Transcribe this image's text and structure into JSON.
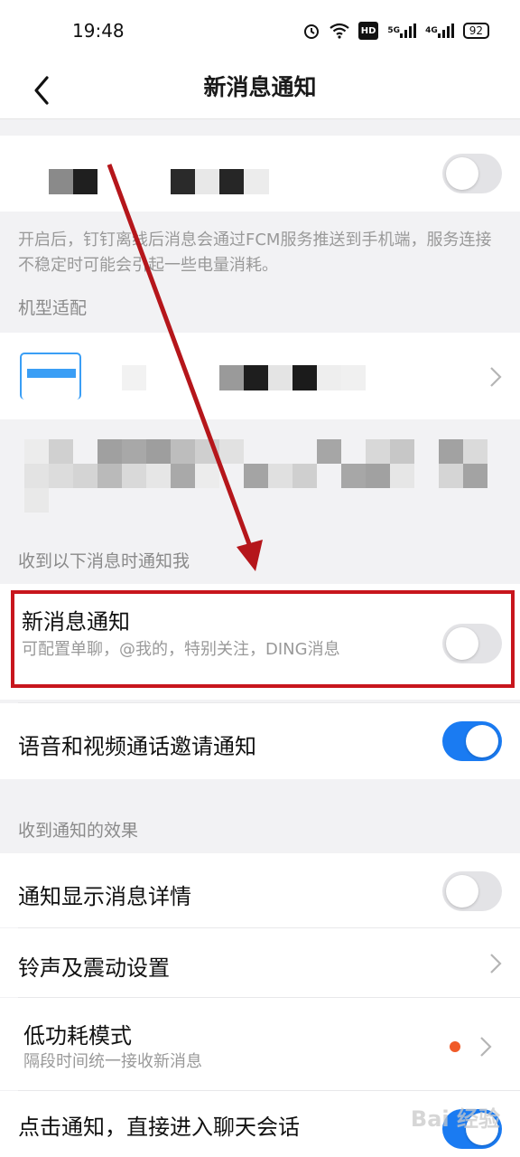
{
  "status_bar": {
    "time": "19:48",
    "battery": "92",
    "network_1": "5G",
    "network_2": "4G",
    "hd_label": "HD"
  },
  "nav": {
    "title": "新消息通知"
  },
  "fcm_note": "开启后，钉钉离线后消息会通过FCM服务推送到手机端，服务连接不稳定时可能会引起一些电量消耗。",
  "model_adapt_label": "机型适配",
  "notify_section_label": "收到以下消息时通知我",
  "new_msg": {
    "title": "新消息通知",
    "subtitle": "可配置单聊，@我的，特别关注，DING消息",
    "enabled": false
  },
  "call_invite": {
    "title": "语音和视频通话邀请通知",
    "enabled": true
  },
  "effect_section_label": "收到通知的效果",
  "show_detail": {
    "title": "通知显示消息详情",
    "enabled": false
  },
  "ringtone": {
    "title": "铃声及震动设置"
  },
  "low_power": {
    "title": "低功耗模式",
    "subtitle": "隔段时间统一接收新消息"
  },
  "tap_notify": {
    "title": "点击通知，直接进入聊天会话",
    "enabled": true
  },
  "watermark": "Bai 经验",
  "colors": {
    "accent": "#1a7bf2",
    "highlight": "#c8161d",
    "dot": "#f05a28"
  }
}
